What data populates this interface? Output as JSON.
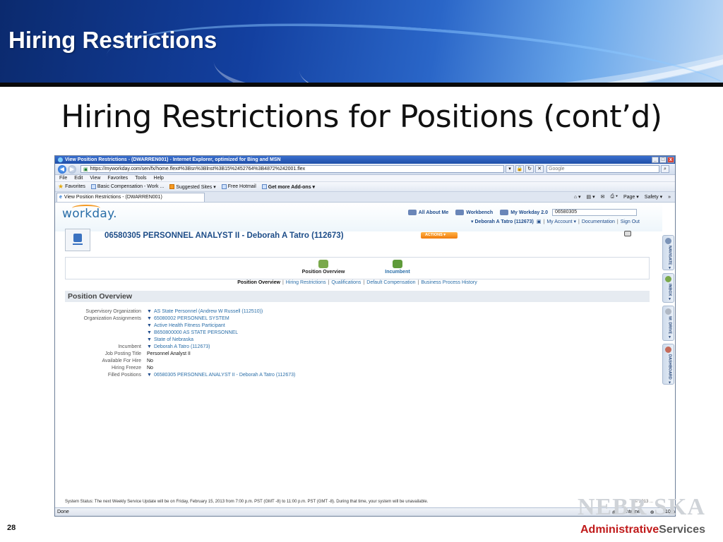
{
  "slide": {
    "banner_title": "Hiring Restrictions",
    "title": "Hiring Restrictions for Positions (cont’d)",
    "page_number": "28",
    "logo_ghost": "NEBR SKA",
    "logo_admin": "Administrative",
    "logo_services": "Services"
  },
  "browser": {
    "window_title": "View Position Restrictions - (DWARREN001) - Internet Explorer, optimized for Bing and MSN",
    "window_buttons": [
      "_",
      "□",
      "x"
    ],
    "address": "https://myworkday.com/sen/fx/home.flex#%3Bsn%3Blnst%3B15%2452764%3B4872%242001.flex",
    "search_placeholder": "Google",
    "menu": [
      "File",
      "Edit",
      "View",
      "Favorites",
      "Tools",
      "Help"
    ],
    "favorites": {
      "label": "Favorites",
      "items": [
        "Basic Compensation - Work ...",
        "Suggested Sites ▾",
        "Free Hotmail",
        "Get more Add-ons ▾"
      ]
    },
    "tab_label": "View Position Restrictions - (DWARREN001)",
    "commands": [
      "Page ▾",
      "Safety ▾"
    ],
    "status_done": "Done",
    "status_zone": "Internet",
    "status_zoom": "110%"
  },
  "workday": {
    "logo": "workday.",
    "links": {
      "about": "All About Me",
      "workbench": "Workbench",
      "my_workday": "My Workday 2.0"
    },
    "search_value": "06580305",
    "user_name": "Deborah A Tatro (112673)",
    "my_account": "My Account ▾",
    "documentation": "Documentation",
    "sign_out": "Sign Out",
    "position_title": "06580305 PERSONNEL ANALYST II - Deborah A Tatro (112673)",
    "actions_label": "ACTIONS ▾",
    "big_tabs": [
      "Position Overview",
      "Incumbent"
    ],
    "sub_tabs": [
      "Position Overview",
      "Hiring Restrictions",
      "Qualifications",
      "Default Compensation",
      "Business Process History"
    ],
    "section_title": "Position Overview",
    "fields": {
      "supervisory_org_label": "Supervisory Organization",
      "supervisory_org_value": "AS State Personnel (Andrew W Russell (112510))",
      "org_assign_label": "Organization Assignments",
      "org_assign_1": "65080002 PERSONNEL SYSTEM",
      "org_assign_2": "Active Health Fitness Participant",
      "org_assign_3": "B650800000 AS STATE PERSONNEL",
      "org_assign_4": "State of Nebraska",
      "incumbent_label": "Incumbent",
      "incumbent_value": "Deborah A Tatro (112673)",
      "job_posting_label": "Job Posting Title",
      "job_posting_value": "Personnel Analyst II",
      "available_label": "Available For Hire",
      "available_value": "No",
      "freeze_label": "Hiring Freeze",
      "freeze_value": "No",
      "filled_label": "Filled Positions",
      "filled_value": "06580305 PERSONNEL ANALYST II - Deborah A Tatro (112673)"
    },
    "side_tabs": [
      "NAVIGATE ▾",
      "INBOX ▾",
      "W: DRIVE ▾",
      "DASHBOARD ▾"
    ],
    "system_status": "System Status: The next Weekly Service Update will be on Friday, February 15, 2013 from 7:00 p.m. PST (GMT -8) to 11:00 p.m. PST (GMT -8). During that time, your system will be unavailable.",
    "copyright": "© 2013 ..."
  }
}
